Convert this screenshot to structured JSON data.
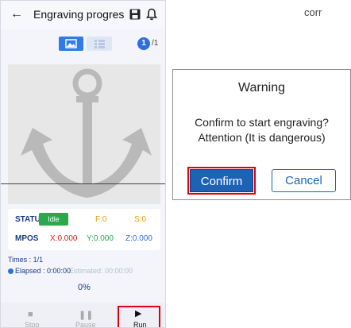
{
  "corner_text": "corr",
  "app": {
    "title": "Engraving progres",
    "page_current": "1",
    "page_total": "/1",
    "status": {
      "statu_label": "STATU",
      "state": "Idle",
      "f_label": "F:0",
      "s_label": "S:0",
      "mpos_label": "MPOS",
      "x": "X:0.000",
      "y": "Y:0.000",
      "z": "Z:0.000"
    },
    "times": "Times : 1/1",
    "elapsed": "Elapsed : 0:00:00",
    "estimated": "Estimated: 00:00:00",
    "progress": "0%",
    "nav": {
      "stop": "Stop",
      "pause": "Pause",
      "run": "Run"
    }
  },
  "dialog": {
    "title": "Warning",
    "message": "Confirm to start engraving? Attention (It is dangerous)",
    "confirm": "Confirm",
    "cancel": "Cancel"
  },
  "colors": {
    "accent": "#1d62b5",
    "highlight": "#e00012",
    "idle": "#2aa84a"
  }
}
